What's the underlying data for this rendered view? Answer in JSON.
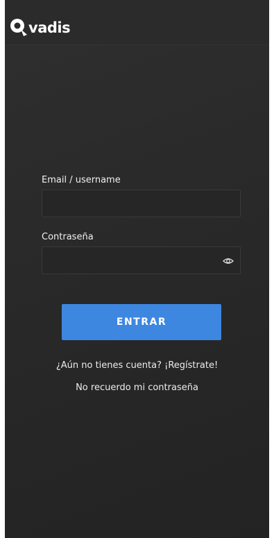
{
  "header": {
    "brand": "vadis",
    "logo_icon": "q-magnifier-logo-icon"
  },
  "form": {
    "email_label": "Email / username",
    "email_value": "",
    "password_label": "Contraseña",
    "password_value": "",
    "toggle_icon": "eye-icon",
    "submit_label": "ENTRAR"
  },
  "links": {
    "register": "¿Aún no tienes cuenta? ¡Regístrate!",
    "forgot": "No recuerdo mi contraseña"
  },
  "colors": {
    "background": "#2b2b2b",
    "accent": "#3d87e0",
    "text": "#ffffff"
  }
}
